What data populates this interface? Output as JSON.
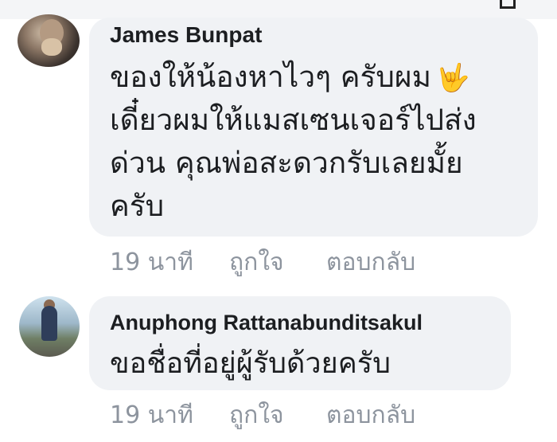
{
  "comments": [
    {
      "author": "James Bunpat",
      "text_lines": [
        "ของให้น้องหาไวๆ ครับผม",
        "เดี๋ยวผมให้แมสเซนเจอร์ไปส่ง",
        "ด่วน คุณพ่อสะดวกรับเลยมั้ย",
        "ครับ"
      ],
      "emoji": "🤟",
      "time": "19 นาที",
      "like_label": "ถูกใจ",
      "reply_label": "ตอบกลับ"
    },
    {
      "author": "Anuphong Rattanabunditsakul",
      "text_lines": [
        "ขอชื่อที่อยู่ผู้รับด้วยครับ"
      ],
      "time": "19 นาที",
      "like_label": "ถูกใจ",
      "reply_label": "ตอบกลับ"
    }
  ],
  "colors": {
    "bubble_bg": "#f0f2f5",
    "author_text": "#1c1e21",
    "meta_text": "#8d949e"
  },
  "icons": {
    "top_corner": "close-icon",
    "emoji": "hand-sign-emoji-icon"
  }
}
